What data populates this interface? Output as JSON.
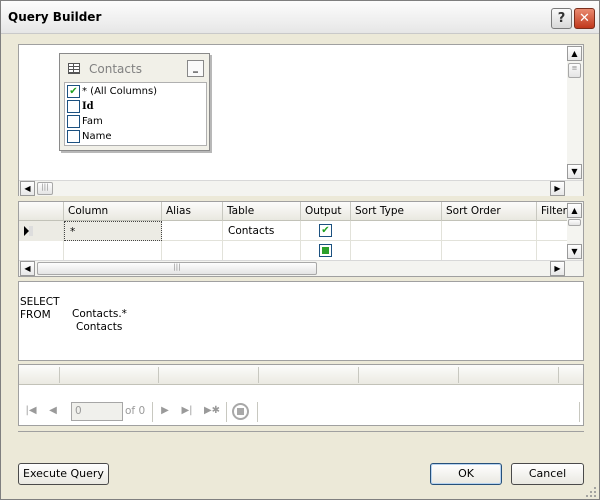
{
  "window": {
    "title": "Query Builder",
    "help_label": "?",
    "close_label": "✕"
  },
  "diagram": {
    "table": {
      "name": "Contacts",
      "minimize_label": "_",
      "columns": [
        {
          "label": "* (All Columns)",
          "checked": true,
          "bold": false
        },
        {
          "label": "Id",
          "checked": false,
          "bold": true
        },
        {
          "label": "Fam",
          "checked": false,
          "bold": false
        },
        {
          "label": "Name",
          "checked": false,
          "bold": false
        }
      ]
    }
  },
  "grid": {
    "headers": [
      "Column",
      "Alias",
      "Table",
      "Output",
      "Sort Type",
      "Sort Order",
      "Filter"
    ],
    "rows": [
      {
        "column": "*",
        "alias": "",
        "table": "Contacts",
        "output": "checked"
      },
      {
        "column": "",
        "alias": "",
        "table": "",
        "output": "indeterminate"
      }
    ]
  },
  "sql": {
    "lines": [
      {
        "keyword": "SELECT",
        "value": "Contacts.*"
      },
      {
        "keyword": "FROM",
        "value": "Contacts"
      }
    ]
  },
  "navigator": {
    "position_value": "0",
    "of_label": "of 0"
  },
  "buttons": {
    "execute": "Execute Query",
    "ok": "OK",
    "cancel": "Cancel"
  },
  "colors": {
    "dialog_bg": "#ece9d8",
    "close_red": "#c0381c",
    "check_green": "#21a121"
  },
  "icons": {
    "table": "table-grid-icon",
    "row_pointer": "row-pointer-icon",
    "first": "first-record-icon",
    "prev": "previous-record-icon",
    "next": "next-record-icon",
    "last": "last-record-icon",
    "new": "new-record-icon",
    "stop": "stop-icon"
  }
}
